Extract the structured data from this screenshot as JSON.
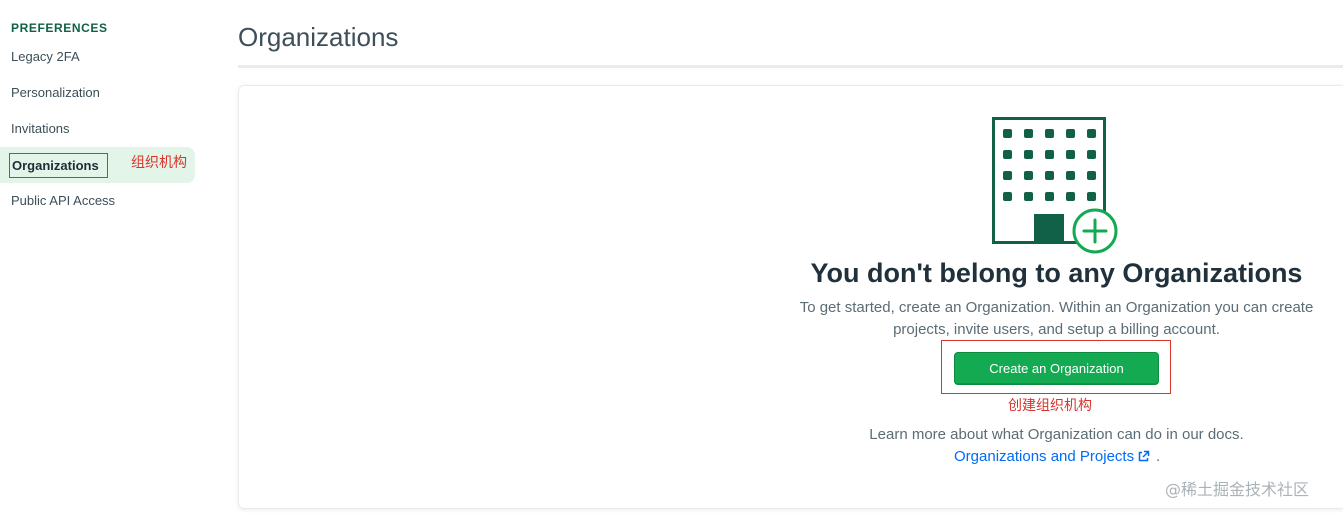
{
  "sidebar": {
    "heading": "PREFERENCES",
    "items": [
      {
        "label": "Legacy 2FA"
      },
      {
        "label": "Personalization"
      },
      {
        "label": "Invitations"
      },
      {
        "label": "Organizations"
      },
      {
        "label": "Public API Access"
      }
    ],
    "active_annotation": "组织机构"
  },
  "main": {
    "title": "Organizations",
    "empty_state": {
      "icon": "building-plus-icon",
      "title": "You don't belong to any Organizations",
      "description": "To get started, create an Organization. Within an Organization you can create projects, invite users, and setup a billing account.",
      "button_label": "Create an Organization",
      "button_annotation": "创建组织机构",
      "learn_more": "Learn more about what Organization can do in our docs.",
      "docs_link": "Organizations and Projects",
      "docs_suffix": "."
    }
  },
  "watermark": "@稀土掘金技术社区",
  "colors": {
    "brand_green": "#13aa52",
    "dark_green": "#116149",
    "active_bg": "#e3f4e8",
    "link_blue": "#016bf8",
    "annotation_red": "#d9342b"
  }
}
